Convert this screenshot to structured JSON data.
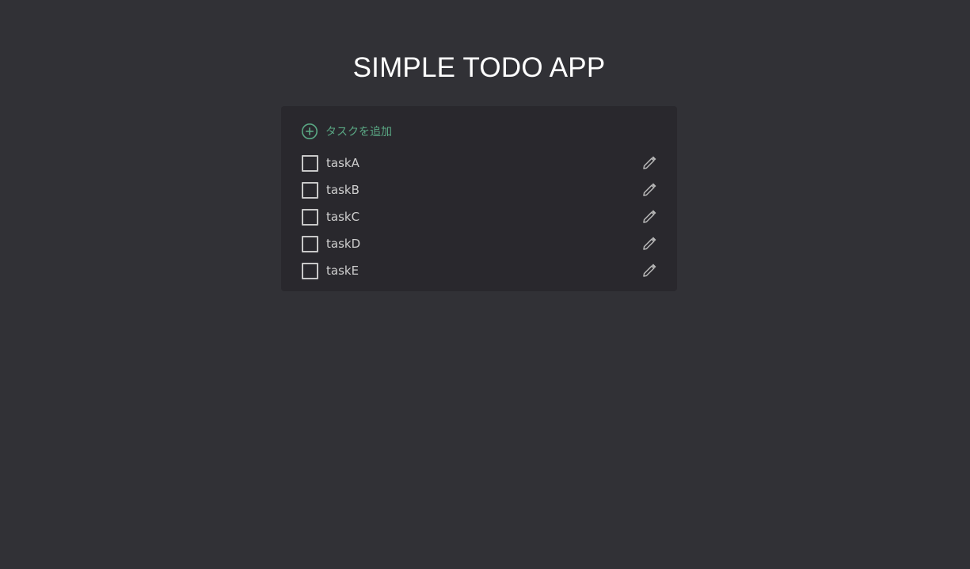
{
  "app": {
    "title": "SIMPLE TODO APP"
  },
  "add_task": {
    "label": "タスクを追加",
    "icon": "plus-circle-icon",
    "color": "#5aa884"
  },
  "tasks": [
    {
      "label": "taskA",
      "checked": false
    },
    {
      "label": "taskB",
      "checked": false
    },
    {
      "label": "taskC",
      "checked": false
    },
    {
      "label": "taskD",
      "checked": false
    },
    {
      "label": "taskE",
      "checked": false
    }
  ],
  "icons": {
    "checkbox": "checkbox-icon",
    "edit": "pencil-icon"
  },
  "colors": {
    "background": "#313136",
    "card": "#29282d",
    "accent": "#5aa884",
    "text": "#cfcfcf"
  }
}
